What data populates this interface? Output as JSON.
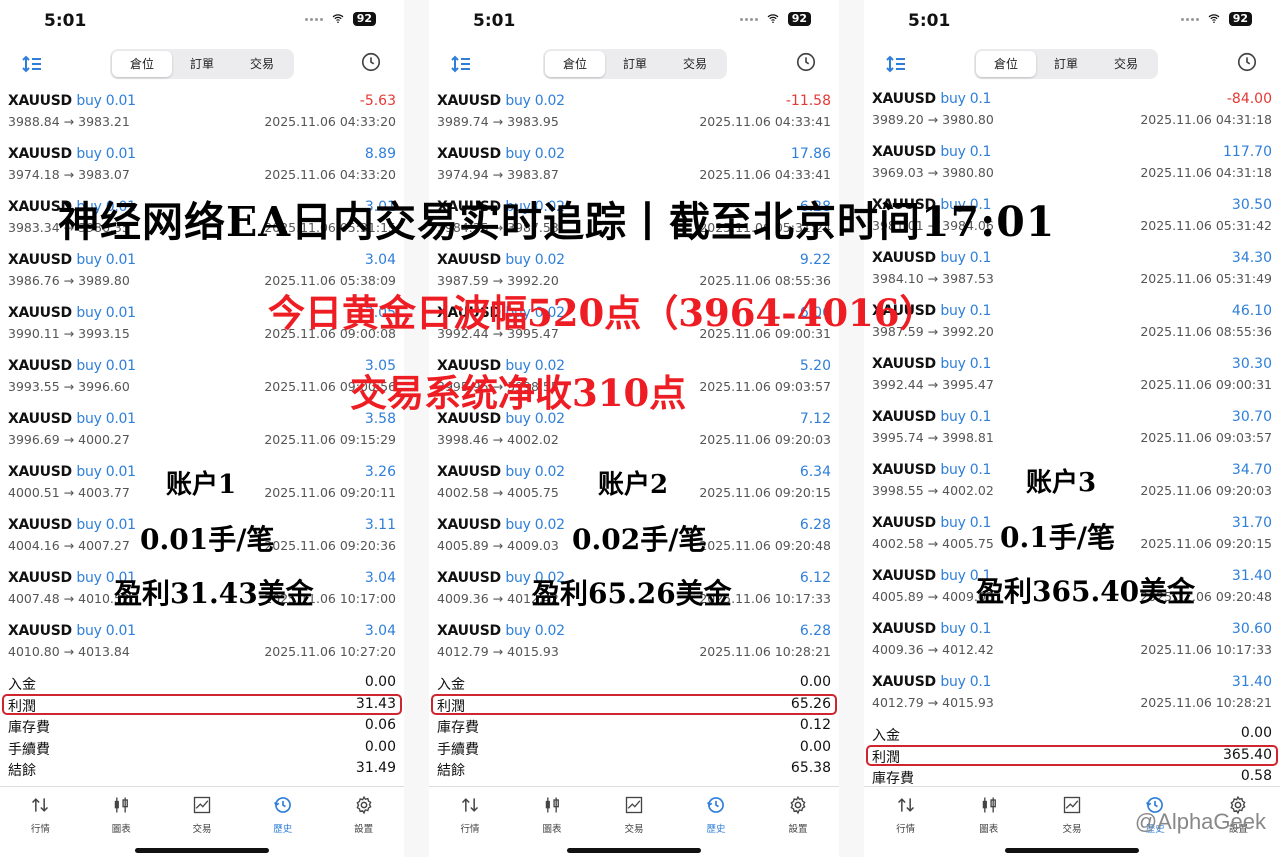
{
  "status_bar": {
    "time": "5:01",
    "battery": "92"
  },
  "segments": [
    "倉位",
    "訂單",
    "交易"
  ],
  "active_segment": "倉位",
  "accent_color": "#2f7fd9",
  "negative_color": "#e53935",
  "highlight_color": "#d0242f",
  "phones": [
    {
      "rows": [
        {
          "symbol": "XAUUSD",
          "side": "buy",
          "volume": "0.01",
          "profit": "-5.63",
          "prices": "3988.84 → 3983.21",
          "time": "2025.11.06 04:33:20"
        },
        {
          "symbol": "XAUUSD",
          "side": "buy",
          "volume": "0.01",
          "profit": "8.89",
          "prices": "3974.18 → 3983.07",
          "time": "2025.11.06 04:33:20"
        },
        {
          "symbol": "XAUUSD",
          "side": "buy",
          "volume": "0.01",
          "profit": "3.01",
          "prices": "3983.34 → 3986.35",
          "time": "2025.11.06 05:31:15"
        },
        {
          "symbol": "XAUUSD",
          "side": "buy",
          "volume": "0.01",
          "profit": "3.04",
          "prices": "3986.76 → 3989.80",
          "time": "2025.11.06 05:38:09"
        },
        {
          "symbol": "XAUUSD",
          "side": "buy",
          "volume": "0.01",
          "profit": "3.05",
          "prices": "3990.11 → 3993.15",
          "time": "2025.11.06 09:00:08"
        },
        {
          "symbol": "XAUUSD",
          "side": "buy",
          "volume": "0.01",
          "profit": "3.05",
          "prices": "3993.55 → 3996.60",
          "time": "2025.11.06 09:00:56"
        },
        {
          "symbol": "XAUUSD",
          "side": "buy",
          "volume": "0.01",
          "profit": "3.58",
          "prices": "3996.69 → 4000.27",
          "time": "2025.11.06 09:15:29"
        },
        {
          "symbol": "XAUUSD",
          "side": "buy",
          "volume": "0.01",
          "profit": "3.26",
          "prices": "4000.51 → 4003.77",
          "time": "2025.11.06 09:20:11"
        },
        {
          "symbol": "XAUUSD",
          "side": "buy",
          "volume": "0.01",
          "profit": "3.11",
          "prices": "4004.16 → 4007.27",
          "time": "2025.11.06 09:20:36"
        },
        {
          "symbol": "XAUUSD",
          "side": "buy",
          "volume": "0.01",
          "profit": "3.04",
          "prices": "4007.48 → 4010.52",
          "time": "2025.11.06 10:17:00"
        },
        {
          "symbol": "XAUUSD",
          "side": "buy",
          "volume": "0.01",
          "profit": "3.04",
          "prices": "4010.80 → 4013.84",
          "time": "2025.11.06 10:27:20"
        }
      ],
      "summary": [
        {
          "label": "入金",
          "value": "0.00"
        },
        {
          "label": "利潤",
          "value": "31.43"
        },
        {
          "label": "庫存費",
          "value": "0.06"
        },
        {
          "label": "手續費",
          "value": "0.00"
        },
        {
          "label": "結餘",
          "value": "31.49"
        }
      ],
      "notes": {
        "account": "账户1",
        "lot": "0.01手/笔",
        "profit": "盈利31.43美金"
      }
    },
    {
      "rows": [
        {
          "symbol": "XAUUSD",
          "side": "buy",
          "volume": "0.02",
          "profit": "-11.58",
          "prices": "3989.74 → 3983.95",
          "time": "2025.11.06 04:33:41"
        },
        {
          "symbol": "XAUUSD",
          "side": "buy",
          "volume": "0.02",
          "profit": "17.86",
          "prices": "3974.94 → 3983.87",
          "time": "2025.11.06 04:33:41"
        },
        {
          "symbol": "XAUUSD",
          "side": "buy",
          "volume": "0.02",
          "profit": "6.28",
          "prices": "3984.35 → 3987.53",
          "time": "2025.11.06 05:31:24"
        },
        {
          "symbol": "XAUUSD",
          "side": "buy",
          "volume": "0.02",
          "profit": "9.22",
          "prices": "3987.59 → 3992.20",
          "time": "2025.11.06 08:55:36"
        },
        {
          "symbol": "XAUUSD",
          "side": "buy",
          "volume": "0.02",
          "profit": "6.06",
          "prices": "3992.44 → 3995.47",
          "time": "2025.11.06 09:00:31"
        },
        {
          "symbol": "XAUUSD",
          "side": "buy",
          "volume": "0.02",
          "profit": "5.20",
          "prices": "3995.95 → 3998.55",
          "time": "2025.11.06 09:03:57"
        },
        {
          "symbol": "XAUUSD",
          "side": "buy",
          "volume": "0.02",
          "profit": "7.12",
          "prices": "3998.46 → 4002.02",
          "time": "2025.11.06 09:20:03"
        },
        {
          "symbol": "XAUUSD",
          "side": "buy",
          "volume": "0.02",
          "profit": "6.34",
          "prices": "4002.58 → 4005.75",
          "time": "2025.11.06 09:20:15"
        },
        {
          "symbol": "XAUUSD",
          "side": "buy",
          "volume": "0.02",
          "profit": "6.28",
          "prices": "4005.89 → 4009.03",
          "time": "2025.11.06 09:20:48"
        },
        {
          "symbol": "XAUUSD",
          "side": "buy",
          "volume": "0.02",
          "profit": "6.12",
          "prices": "4009.36 → 4012.42",
          "time": "2025.11.06 10:17:33"
        },
        {
          "symbol": "XAUUSD",
          "side": "buy",
          "volume": "0.02",
          "profit": "6.28",
          "prices": "4012.79 → 4015.93",
          "time": "2025.11.06 10:28:21"
        }
      ],
      "summary": [
        {
          "label": "入金",
          "value": "0.00"
        },
        {
          "label": "利潤",
          "value": "65.26"
        },
        {
          "label": "庫存費",
          "value": "0.12"
        },
        {
          "label": "手續費",
          "value": "0.00"
        },
        {
          "label": "結餘",
          "value": "65.38"
        }
      ],
      "notes": {
        "account": "账户2",
        "lot": "0.02手/笔",
        "profit": "盈利65.26美金"
      }
    },
    {
      "rows": [
        {
          "symbol": "XAUUSD",
          "side": "buy",
          "volume": "0.1",
          "profit": "-84.00",
          "prices": "3989.20 → 3980.80",
          "time": "2025.11.06 04:31:18"
        },
        {
          "symbol": "XAUUSD",
          "side": "buy",
          "volume": "0.1",
          "profit": "117.70",
          "prices": "3969.03 → 3980.80",
          "time": "2025.11.06 04:31:18"
        },
        {
          "symbol": "XAUUSD",
          "side": "buy",
          "volume": "0.1",
          "profit": "30.50",
          "prices": "3981.01 → 3984.06",
          "time": "2025.11.06 05:31:42"
        },
        {
          "symbol": "XAUUSD",
          "side": "buy",
          "volume": "0.1",
          "profit": "34.30",
          "prices": "3984.10 → 3987.53",
          "time": "2025.11.06 05:31:49"
        },
        {
          "symbol": "XAUUSD",
          "side": "buy",
          "volume": "0.1",
          "profit": "46.10",
          "prices": "3987.59 → 3992.20",
          "time": "2025.11.06 08:55:36"
        },
        {
          "symbol": "XAUUSD",
          "side": "buy",
          "volume": "0.1",
          "profit": "30.30",
          "prices": "3992.44 → 3995.47",
          "time": "2025.11.06 09:00:31"
        },
        {
          "symbol": "XAUUSD",
          "side": "buy",
          "volume": "0.1",
          "profit": "30.70",
          "prices": "3995.74 → 3998.81",
          "time": "2025.11.06 09:03:57"
        },
        {
          "symbol": "XAUUSD",
          "side": "buy",
          "volume": "0.1",
          "profit": "34.70",
          "prices": "3998.55 → 4002.02",
          "time": "2025.11.06 09:20:03"
        },
        {
          "symbol": "XAUUSD",
          "side": "buy",
          "volume": "0.1",
          "profit": "31.70",
          "prices": "4002.58 → 4005.75",
          "time": "2025.11.06 09:20:15"
        },
        {
          "symbol": "XAUUSD",
          "side": "buy",
          "volume": "0.1",
          "profit": "31.40",
          "prices": "4005.89 → 4009.03",
          "time": "2025.11.06 09:20:48"
        },
        {
          "symbol": "XAUUSD",
          "side": "buy",
          "volume": "0.1",
          "profit": "30.60",
          "prices": "4009.36 → 4012.42",
          "time": "2025.11.06 10:17:33"
        },
        {
          "symbol": "XAUUSD",
          "side": "buy",
          "volume": "0.1",
          "profit": "31.40",
          "prices": "4012.79 → 4015.93",
          "time": "2025.11.06 10:28:21"
        }
      ],
      "summary": [
        {
          "label": "入金",
          "value": "0.00"
        },
        {
          "label": "利潤",
          "value": "365.40"
        },
        {
          "label": "庫存費",
          "value": "0.58"
        }
      ],
      "notes": {
        "account": "账户3",
        "lot": "0.1手/笔",
        "profit": "盈利365.40美金"
      }
    }
  ],
  "tabbar": [
    {
      "label": "行情",
      "icon": "arrows-updown-icon"
    },
    {
      "label": "圖表",
      "icon": "candlestick-icon"
    },
    {
      "label": "交易",
      "icon": "trade-chart-icon"
    },
    {
      "label": "歷史",
      "icon": "history-icon",
      "active": true
    },
    {
      "label": "設置",
      "icon": "gear-icon"
    }
  ],
  "overlay": {
    "title": "神经网络EA日内交易实时追踪丨截至北京时间17:01",
    "sub1": "今日黄金日波幅520点（3964-4016）",
    "sub2": "交易系统净收310点"
  },
  "watermark": "@AlphaGeek"
}
